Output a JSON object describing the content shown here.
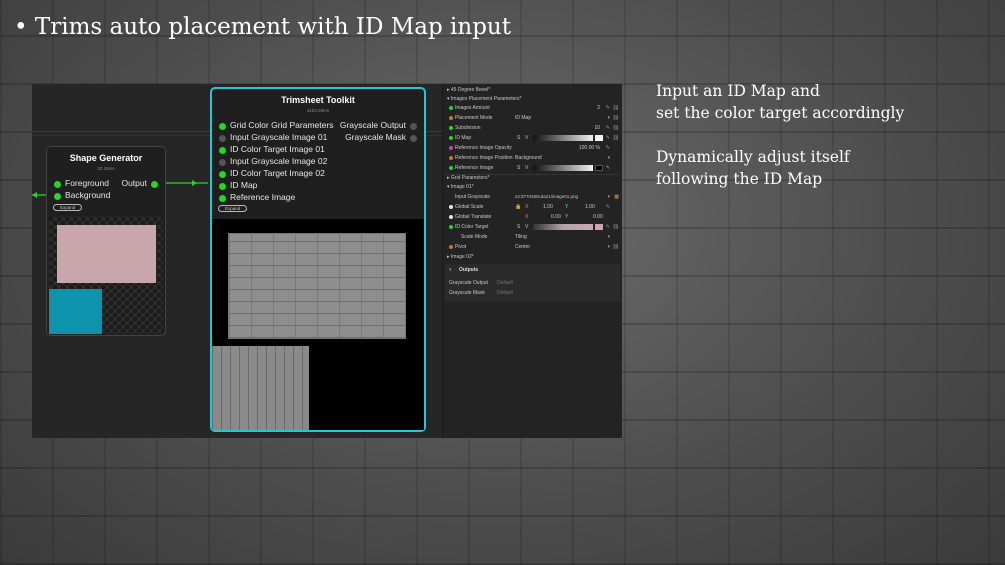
{
  "headline": "• Trims auto placement with ID Map input",
  "notes": [
    {
      "line1": "Input an ID Map and",
      "line2": "set the color target accordingly"
    },
    {
      "line1": "Dynamically adjust itself",
      "line2": "following the ID Map"
    }
  ],
  "shape_node": {
    "title": "Shape Generator",
    "time": "20.19ms",
    "inputs": [
      "Foreground",
      "Background"
    ],
    "output": "Output",
    "expand": "Expand"
  },
  "trim_node": {
    "title": "Trimsheet Toolkit",
    "time": "3182.59ms",
    "inputs": [
      {
        "label": "Grid Color Grid Parameters",
        "connected": true
      },
      {
        "label": "Input Grayscale Image 01",
        "connected": false
      },
      {
        "label": "ID Color Target Image 01",
        "connected": true
      },
      {
        "label": "Input Grayscale Image 02",
        "connected": false
      },
      {
        "label": "ID Color Target Image 02",
        "connected": true
      },
      {
        "label": "ID Map",
        "connected": true
      },
      {
        "label": "Reference Image",
        "connected": true
      }
    ],
    "outputs": [
      "Grayscale Output",
      "Grayscale Mask"
    ],
    "expand": "Expand"
  },
  "props": {
    "sec_45": "▸ 45 Degree Bevel*",
    "sec_images_placement": "▾ Images Placement Parameters*",
    "images_amount": {
      "label": "Images Amount",
      "value": "2"
    },
    "placement_mode": {
      "label": "Placement Mode",
      "value": "ID Map"
    },
    "subdivision": {
      "label": "Subdivision",
      "value": "10"
    },
    "id_map": {
      "label": "ID Map",
      "s": "S",
      "v": "V"
    },
    "ref_opacity": {
      "label": "Reference Image Opacity",
      "value": "100.00 %"
    },
    "ref_position": {
      "label": "Reference Image Position",
      "value": "Background"
    },
    "ref_image": {
      "label": "Reference Image",
      "s": "S",
      "v": "V"
    },
    "sec_grid": "▸ Grid Parameters*",
    "sec_image01": "▾ Image 01*",
    "input_grayscale": {
      "label": "Input Grayscale",
      "value": "s3:3770480cda21/image01.png"
    },
    "global_scale": {
      "label": "Global Scale",
      "x_label": "X",
      "x": "1.00",
      "y_label": "Y",
      "y": "1.00"
    },
    "global_translate": {
      "label": "Global Translate",
      "x_label": "X",
      "x": "0.00",
      "y_label": "Y",
      "y": "0.00"
    },
    "id_color_target": {
      "label": "ID Color Target",
      "s": "S",
      "v": "V"
    },
    "scale_mode": {
      "label": "Scale Mode",
      "value": "Tiling"
    },
    "pivot": {
      "label": "Pivot",
      "value": "Center"
    },
    "sec_image02": "▸ Image 02*",
    "outputs_header": "Outputs",
    "out1": {
      "label": "Grayscale Output",
      "value": "Default"
    },
    "out2": {
      "label": "Grayscale Mask",
      "value": "Default"
    }
  },
  "colors": {
    "port_connected": "#22d922",
    "selected_border": "#26c6d6",
    "shape_pink": "#c9a6ab",
    "shape_blue": "#0e93ad"
  }
}
